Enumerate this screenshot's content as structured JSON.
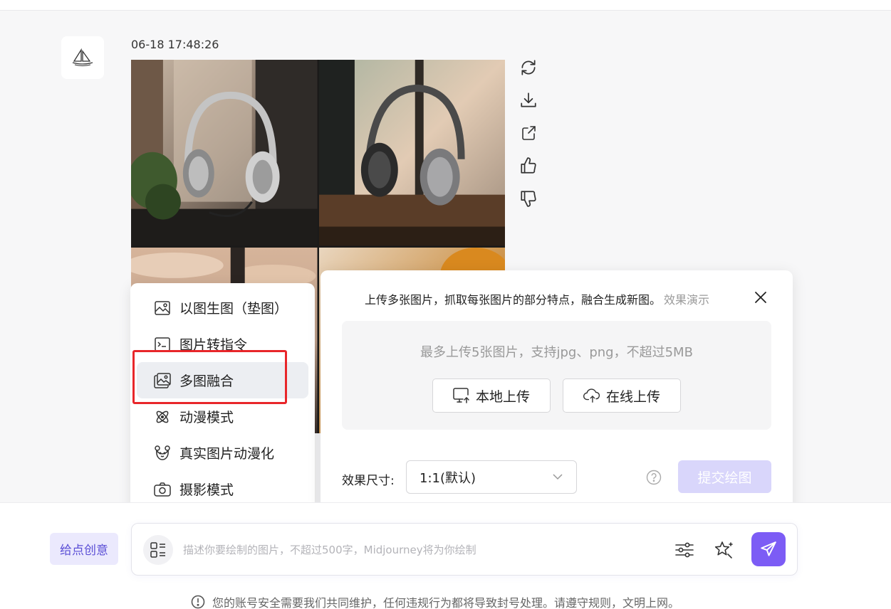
{
  "message": {
    "timestamp": "06-18 17:48:26",
    "avatar_icon": "sailboat-logo-icon",
    "image_tiles": [
      "headphones-window-plant",
      "headphones-rainy-window",
      "headphones-sunset-clouds",
      "headphones-autumn-leaves"
    ],
    "actions": [
      "refresh-icon",
      "download-icon",
      "share-icon",
      "thumbs-up-icon",
      "thumbs-down-icon"
    ]
  },
  "tools_menu": {
    "items": [
      {
        "label": "以图生图（垫图）",
        "icon": "image-icon"
      },
      {
        "label": "图片转指令",
        "icon": "terminal-icon"
      },
      {
        "label": "多图融合",
        "icon": "images-merge-icon",
        "active": true
      },
      {
        "label": "动漫模式",
        "icon": "atom-icon"
      },
      {
        "label": "真实图片动漫化",
        "icon": "bear-face-icon"
      },
      {
        "label": "摄影模式",
        "icon": "camera-icon"
      }
    ]
  },
  "blend_panel": {
    "description": "上传多张图片，抓取每张图片的部分特点，融合生成新图。",
    "demo_link": "效果演示",
    "upload_hint": "最多上传5张图片，支持jpg、png，不超过5MB",
    "local_upload": "本地上传",
    "online_upload": "在线上传",
    "size_label": "效果尺寸:",
    "size_value": "1:1(默认)",
    "submit": "提交绘图"
  },
  "composer": {
    "idea_button": "给点创意",
    "placeholder": "描述你要绘制的图片，不超过500字，Midjourney将为你绘制",
    "value": ""
  },
  "notice": "您的账号安全需要我们共同维护，任何违规行为都将导致封号处理。请遵守规则，文明上网。",
  "colors": {
    "accent": "#7c5cf5",
    "submit_disabled": "#d9d6fb",
    "highlight": "#e8262a"
  }
}
